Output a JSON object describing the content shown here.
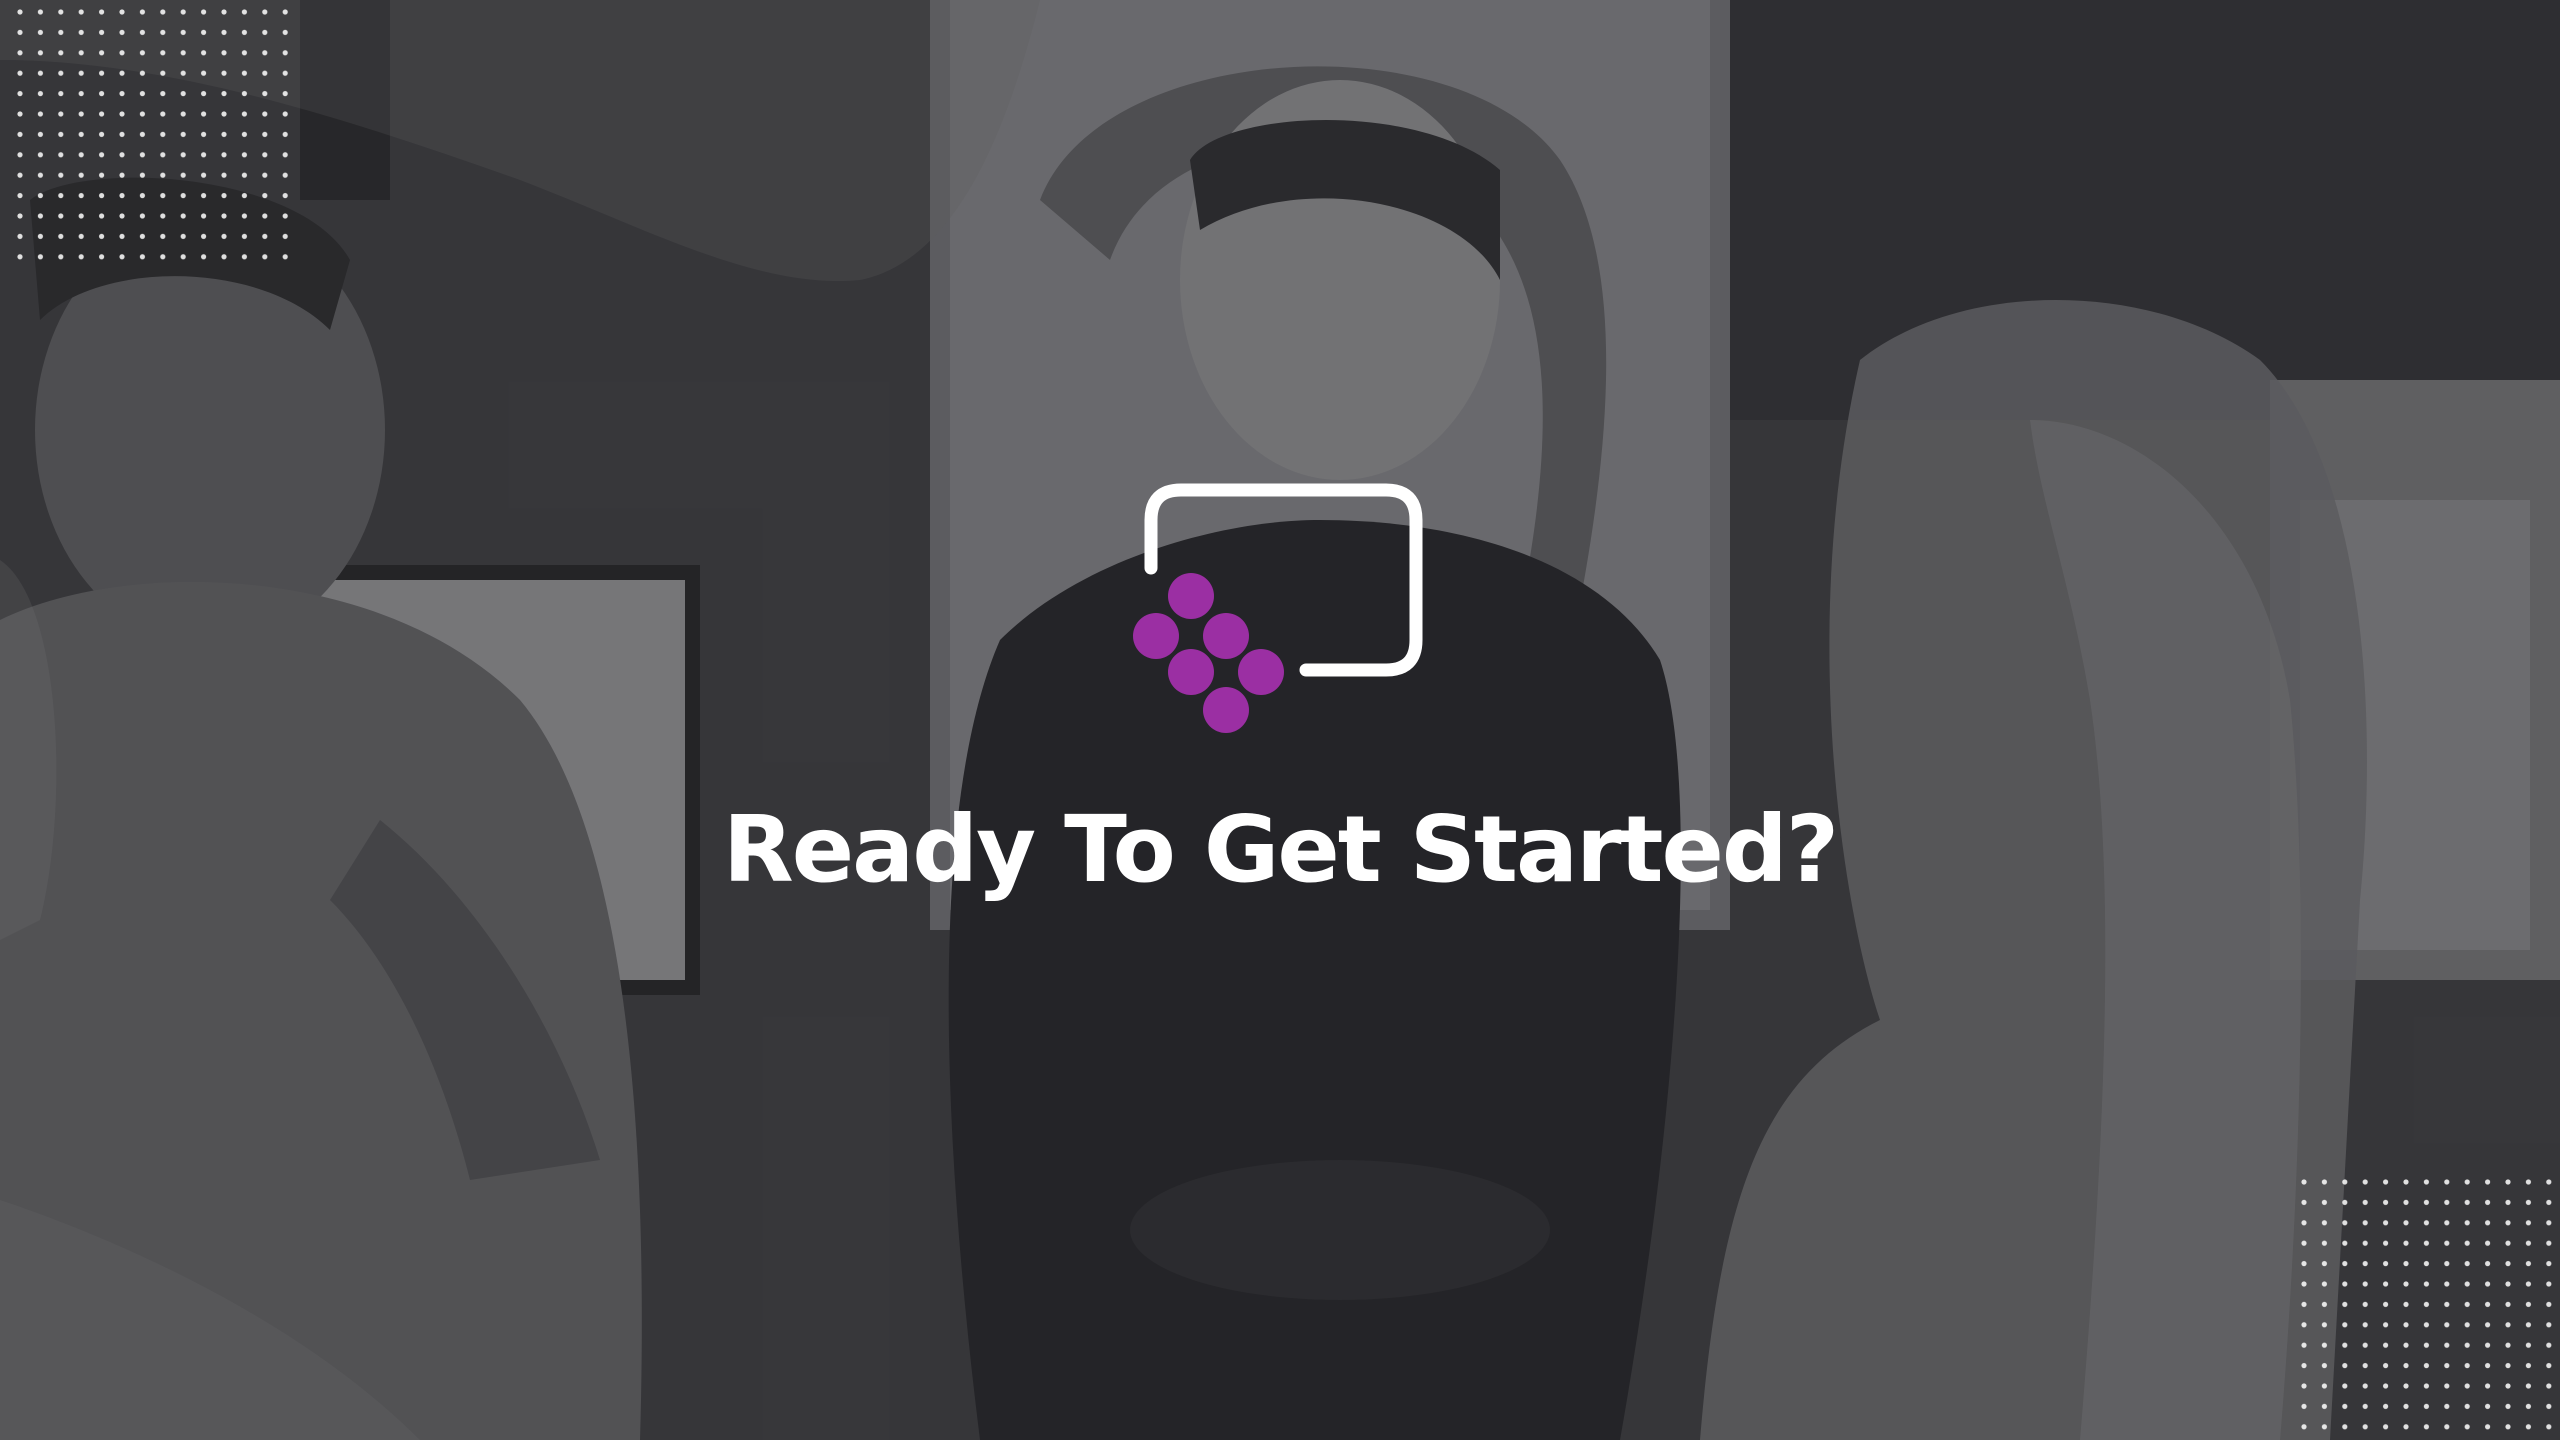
{
  "slide": {
    "headline": "Ready To Get Started?"
  },
  "colors": {
    "accent": "#9b2fa3",
    "text": "#ffffff",
    "dots": "#ffffff"
  },
  "icons": {
    "logo": "brand-logo-icon",
    "decoration": "dot-grid-pattern"
  }
}
